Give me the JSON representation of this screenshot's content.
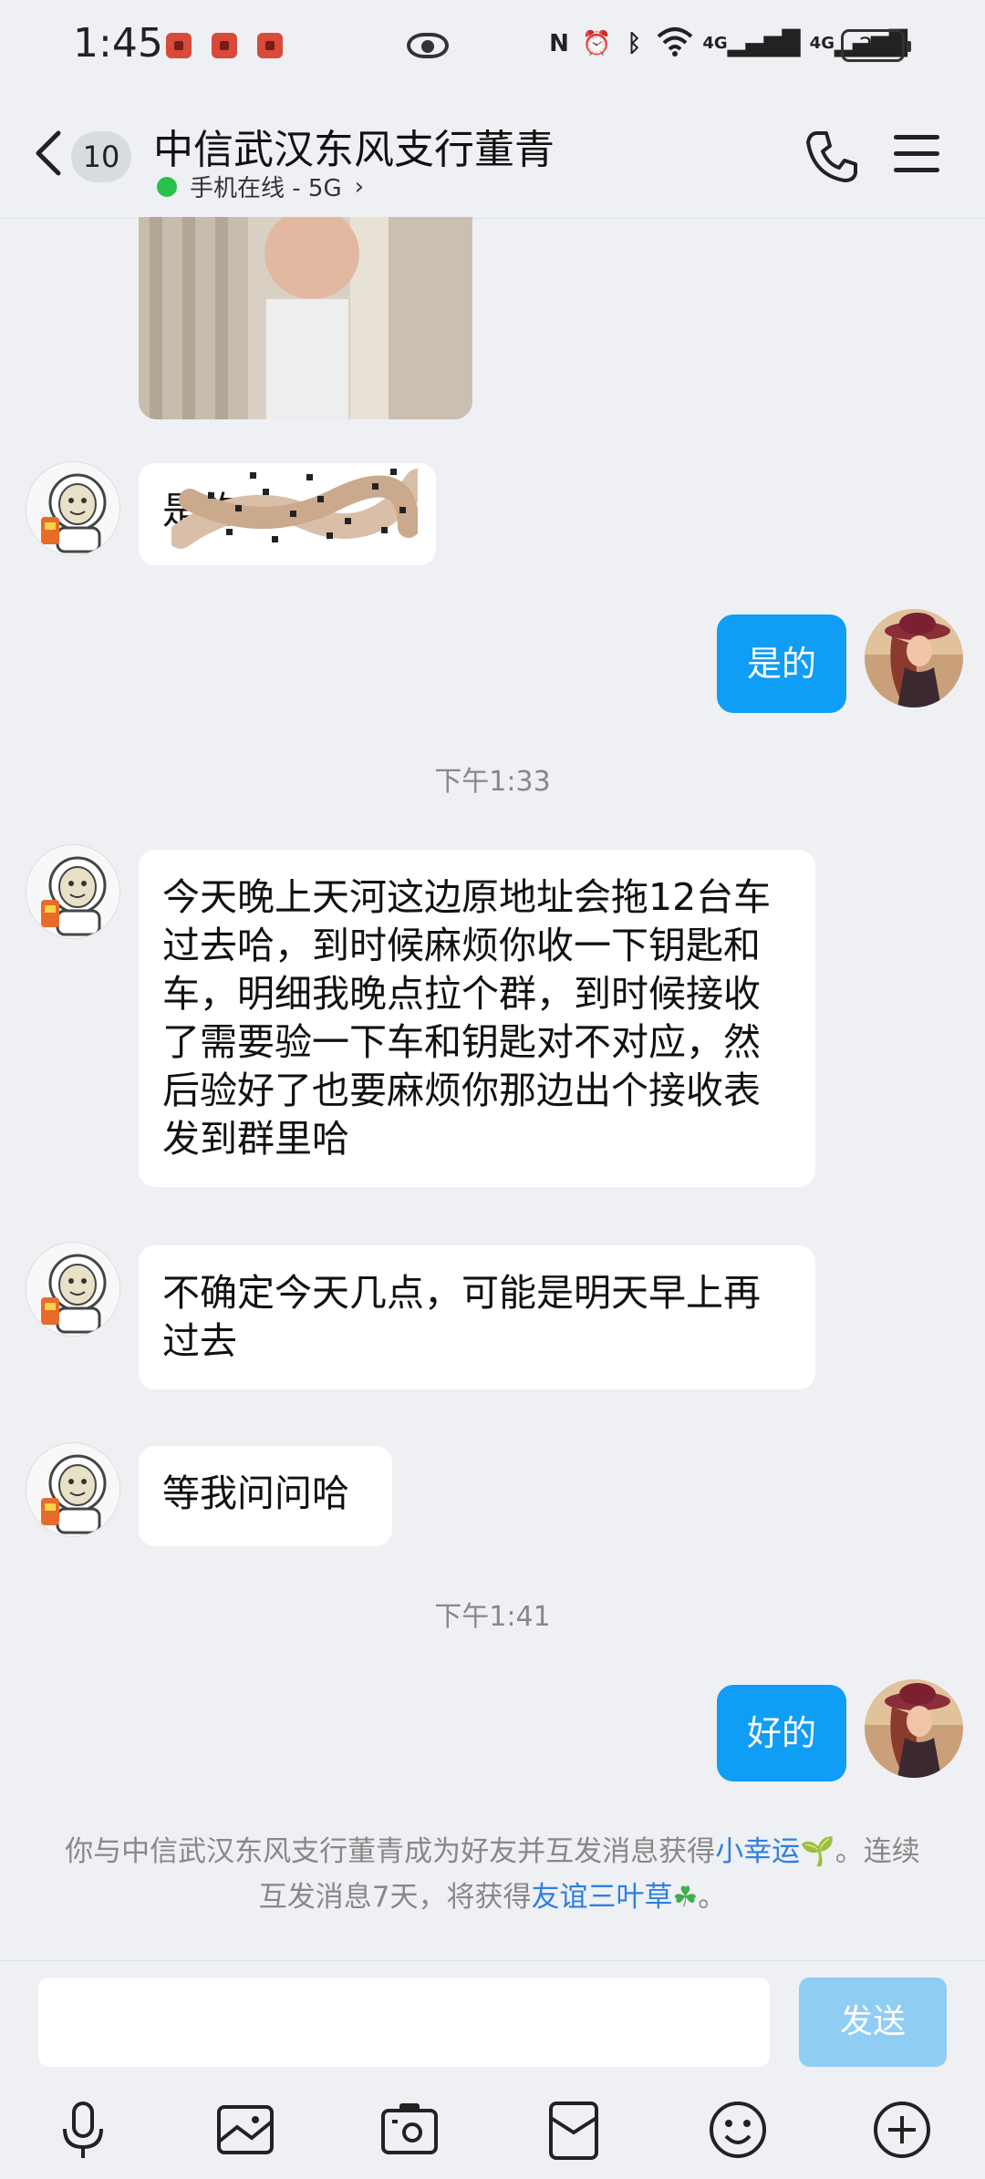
{
  "status_bar": {
    "time": "1:45",
    "nfc": "N",
    "signal_1": "4G",
    "signal_2": "4G",
    "battery": "23"
  },
  "header": {
    "unread_count": "10",
    "title": "中信武汉东风支行董青",
    "online_status": "手机在线 - 5G",
    "chevron": "›"
  },
  "messages": {
    "m1_text": "是的…",
    "m2_text": "是的",
    "time_1": "下午1:33",
    "m3_text": "今天晚上天河这边原地址会拖12台车过去哈，到时候麻烦你收一下钥匙和车，明细我晚点拉个群，到时候接收了需要验一下车和钥匙对不对应，然后验好了也要麻烦你那边出个接收表发到群里哈",
    "m4_text": "不确定今天几点，可能是明天早上再过去",
    "m5_text": "等我问问哈",
    "time_2": "下午1:41",
    "m6_text": "好的"
  },
  "system_note": {
    "part1": "你与中信武汉东风支行董青成为好友并互发消息获得",
    "link1": "小幸运",
    "emoji1": "🌱",
    "part2": "。连续互发消息7天，将获得",
    "link2": "友谊三叶草",
    "emoji2": "☘",
    "part3": "。"
  },
  "input": {
    "placeholder": "",
    "send_label": "发送"
  },
  "toolbar": {
    "icons": [
      "microphone-icon",
      "image-icon",
      "camera-icon",
      "red-packet-icon",
      "emoji-icon",
      "plus-icon"
    ]
  },
  "colors": {
    "accent": "#0f9df5",
    "send_disabled": "#8fcdf4",
    "background": "#eef0f4",
    "link": "#2f7fe0",
    "online": "#27c24c"
  }
}
